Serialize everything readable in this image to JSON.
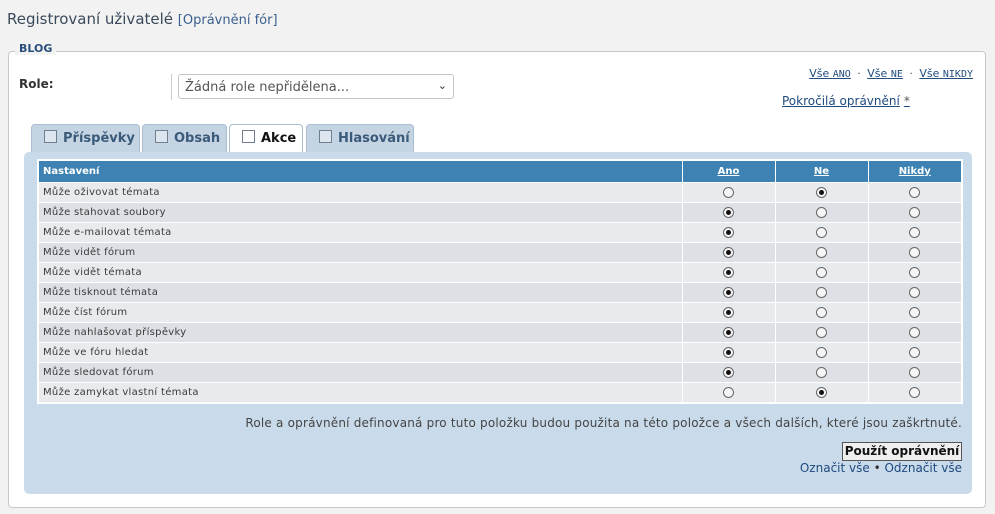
{
  "header": {
    "title": "Registrovaní uživatelé",
    "subtitle": "[Oprávnění fór]"
  },
  "fieldset": {
    "legend": "BLOG"
  },
  "role": {
    "label": "Role:",
    "selected": "Žádná role nepřidělena...",
    "caret": "⌄"
  },
  "quick": {
    "all_prefix": "Vše",
    "yes": "ANO",
    "no": "NE",
    "never": "NIKDY",
    "sep": "·",
    "advanced": "Pokročilá oprávnění",
    "star": "*"
  },
  "tabs": [
    {
      "label": "Příspěvky",
      "active": false
    },
    {
      "label": "Obsah",
      "active": false
    },
    {
      "label": "Akce",
      "active": true
    },
    {
      "label": "Hlasování",
      "active": false
    }
  ],
  "table": {
    "headers": [
      "Nastavení",
      "Ano",
      "Ne",
      "Nikdy"
    ],
    "rows": [
      {
        "label": "Může oživovat témata",
        "value": "Ne"
      },
      {
        "label": "Může stahovat soubory",
        "value": "Ano"
      },
      {
        "label": "Může e-mailovat témata",
        "value": "Ano"
      },
      {
        "label": "Může vidět fórum",
        "value": "Ano"
      },
      {
        "label": "Může vidět témata",
        "value": "Ano"
      },
      {
        "label": "Může tisknout témata",
        "value": "Ano"
      },
      {
        "label": "Může číst fórum",
        "value": "Ano"
      },
      {
        "label": "Může nahlašovat příspěvky",
        "value": "Ano"
      },
      {
        "label": "Může ve fóru hledat",
        "value": "Ano"
      },
      {
        "label": "Může sledovat fórum",
        "value": "Ano"
      },
      {
        "label": "Může zamykat vlastní témata",
        "value": "Ne"
      }
    ]
  },
  "note": "Role a oprávnění definovaná pro tuto položku budou použita na této položce a všech dalších, které jsou zaškrtnuté.",
  "apply_label": "Použít oprávnění",
  "mark": {
    "all": "Označit vše",
    "sep": "•",
    "none": "Odznačit vše"
  }
}
